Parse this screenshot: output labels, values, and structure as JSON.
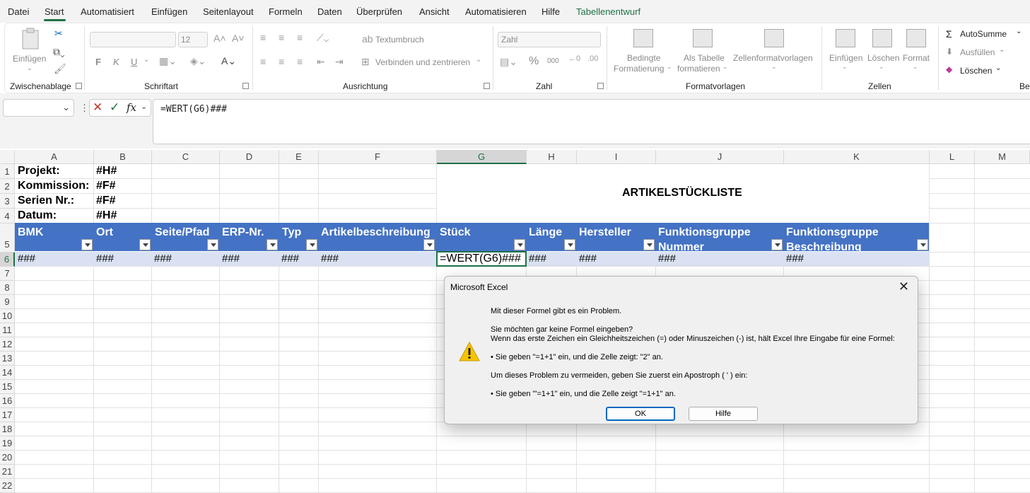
{
  "menu": {
    "tabs": [
      "Datei",
      "Start",
      "Automatisiert",
      "Einfügen",
      "Seitenlayout",
      "Formeln",
      "Daten",
      "Überprüfen",
      "Ansicht",
      "Automatisieren",
      "Hilfe",
      "Tabellenentwurf"
    ]
  },
  "ribbon": {
    "clipboard": {
      "paste": "Einfügen",
      "group": "Zwischenablage"
    },
    "font": {
      "size": "12",
      "bold": "F",
      "italic": "K",
      "underline": "U",
      "group": "Schriftart"
    },
    "alignment": {
      "wrap": "Textumbruch",
      "merge": "Verbinden und zentrieren",
      "group": "Ausrichtung"
    },
    "number": {
      "format": "Zahl",
      "percent": "%",
      "thousands": "000",
      "group": "Zahl"
    },
    "styles": {
      "conditional1": "Bedingte",
      "conditional2": "Formatierung",
      "table1": "Als Tabelle",
      "table2": "formatieren",
      "cell": "Zellenformatvorlagen",
      "group": "Formatvorlagen"
    },
    "cells": {
      "insert": "Einfügen",
      "delete": "Löschen",
      "format": "Format",
      "group": "Zellen"
    },
    "editing": {
      "autosum": "AutoSumme",
      "fill": "Ausfüllen",
      "clear": "Löschen",
      "group": "Bea"
    }
  },
  "formula_bar": {
    "fx": "fx",
    "content": "=WERT(G6)###"
  },
  "columns": [
    "A",
    "B",
    "C",
    "D",
    "E",
    "F",
    "G",
    "H",
    "I",
    "J",
    "K",
    "L",
    "M"
  ],
  "rows": [
    "1",
    "2",
    "3",
    "4",
    "5",
    "6",
    "7",
    "8",
    "9",
    "10",
    "11",
    "12",
    "13",
    "14",
    "15",
    "16",
    "17",
    "18",
    "19",
    "20",
    "21",
    "22"
  ],
  "info": {
    "projekt_label": "Projekt:",
    "projekt_value": "#H#",
    "kommission_label": "Kommission:",
    "kommission_value": "#F#",
    "serien_label": "Serien Nr.:",
    "serien_value": "#F#",
    "datum_label": "Datum:",
    "datum_value": "#H#",
    "title": "ARTIKELSTÜCKLISTE"
  },
  "table_headers": {
    "bmk": "BMK",
    "ort": "Ort",
    "seite": "Seite/Pfad",
    "erp": "ERP-Nr.",
    "typ": "Typ",
    "artikel": "Artikelbeschreibung",
    "stueck": "Stück",
    "laenge": "Länge",
    "hersteller": "Hersteller",
    "fg_nr_1": "Funktionsgruppe",
    "fg_nr_2": "Nummer",
    "fg_be_1": "Funktionsgruppe",
    "fg_be_2": "Beschreibung"
  },
  "row6": {
    "a": "###",
    "b": "###",
    "c": "###",
    "d": "###",
    "e": "###",
    "f": "###",
    "g": "=WERT(G6)###",
    "h": "###",
    "i": "###",
    "j": "###",
    "k": "###"
  },
  "dialog": {
    "title": "Microsoft Excel",
    "line1": "Mit dieser Formel gibt es ein Problem.",
    "line2": "Sie möchten gar keine Formel eingeben?",
    "line3": "Wenn das erste Zeichen ein Gleichheitszeichen (=) oder Minuszeichen (-) ist, hält Excel Ihre Eingabe für eine Formel:",
    "line4": "• Sie geben \"=1+1\" ein, und die Zelle zeigt: \"2\" an.",
    "line5": "Um dieses Problem zu vermeiden, geben Sie zuerst ein Apostroph ( ' ) ein:",
    "line6": "• Sie geben \"'=1+1\" ein, und die Zelle zeigt \"=1+1\" an.",
    "ok": "OK",
    "help": "Hilfe"
  },
  "colors": {
    "accent": "#1e7145",
    "table_header": "#4472c4",
    "table_row": "#d9e1f2"
  }
}
